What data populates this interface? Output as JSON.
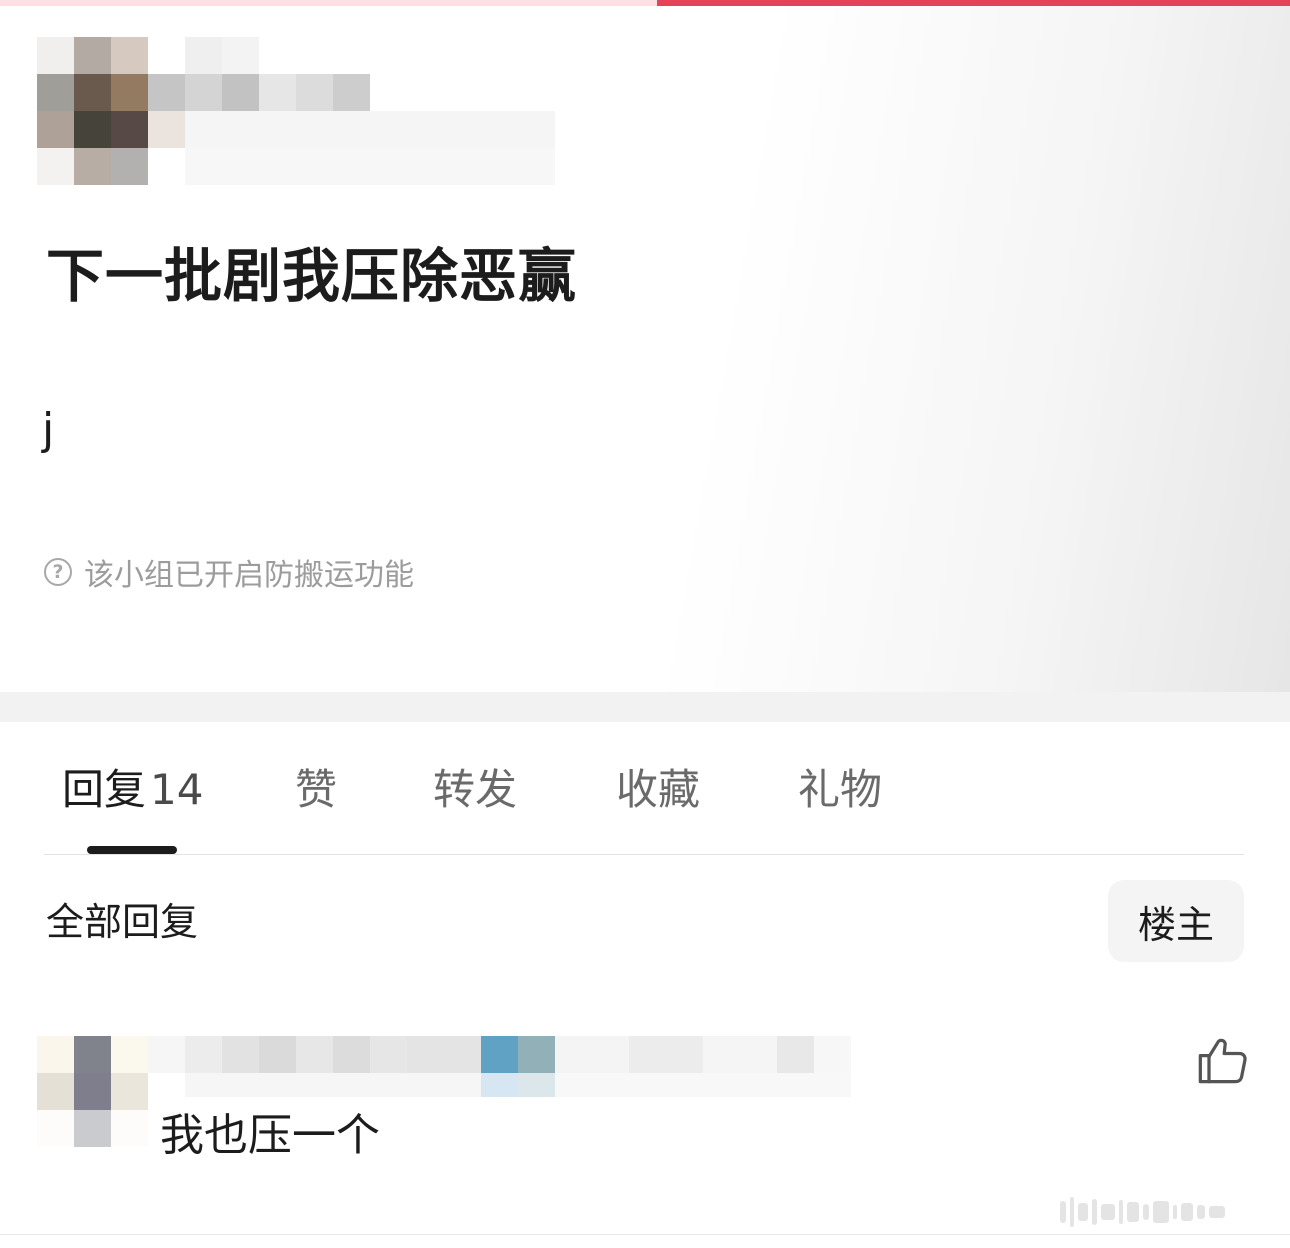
{
  "post": {
    "title": "下一批剧我压除恶赢",
    "body": "j",
    "notice": "该小组已开启防搬运功能",
    "notice_icon": "question-circle-icon"
  },
  "tabs": [
    {
      "label": "回复",
      "count": "14"
    },
    {
      "label": "赞"
    },
    {
      "label": "转发"
    },
    {
      "label": "收藏"
    },
    {
      "label": "礼物"
    }
  ],
  "replies": {
    "section_title": "全部回复",
    "op_filter_label": "楼主",
    "items": [
      {
        "text": "我也压一个",
        "like_icon": "thumbs-up-icon"
      }
    ]
  },
  "colors": {
    "accent": "#e5425a",
    "accent_light": "#fde0e4",
    "divider": "#f2f2f2"
  }
}
